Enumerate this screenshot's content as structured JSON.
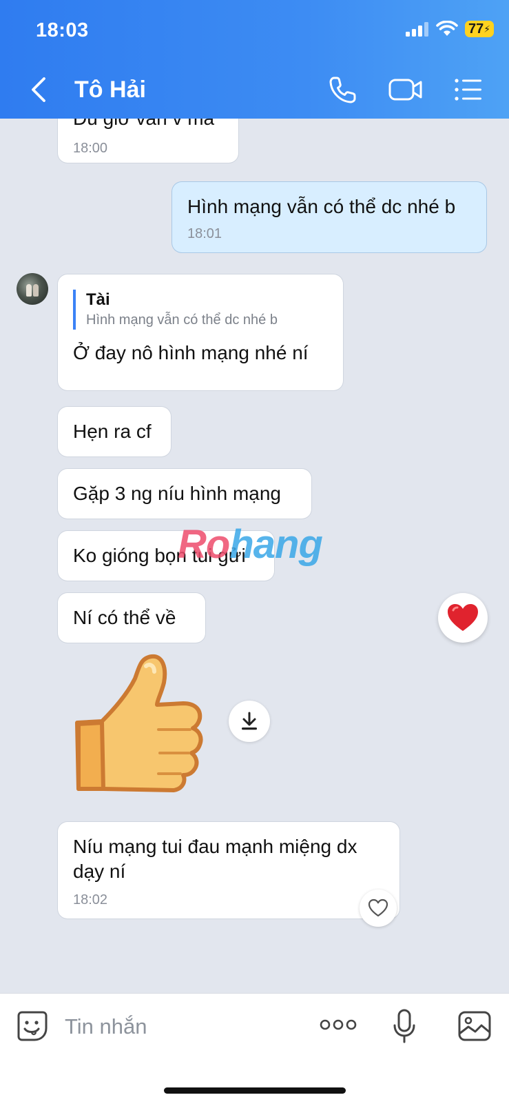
{
  "status_bar": {
    "time": "18:03",
    "battery": "77"
  },
  "header": {
    "contact_name": "Tô Hải"
  },
  "messages": [
    {
      "text": "Đủ giờ vẫn v mà",
      "time": "18:00"
    },
    {
      "text": "Hình mạng vẫn có thể dc nhé b",
      "time": "18:01"
    },
    {
      "quote_author": "Tài",
      "quote_text": "Hình mạng vẫn có thể dc nhé b",
      "text": "Ở đay nô hình mạng nhé ní"
    },
    {
      "text": "Hẹn ra cf"
    },
    {
      "text": "Gặp 3 ng níu hình mạng"
    },
    {
      "text": "Ko gióng bọn tui gửi"
    },
    {
      "text": "Ní có thể về"
    },
    {
      "text": "Níu mạng tui đau mạnh miệng dx dạy ní",
      "time": "18:02"
    }
  ],
  "watermark": {
    "part1": "Ro",
    "part2": "hang"
  },
  "input": {
    "placeholder": "Tin nhắn"
  },
  "colors": {
    "header": "#3a86f2",
    "heart": "#e0232e",
    "sent_bubble": "#d8eeff",
    "background": "#e2e6ee"
  }
}
